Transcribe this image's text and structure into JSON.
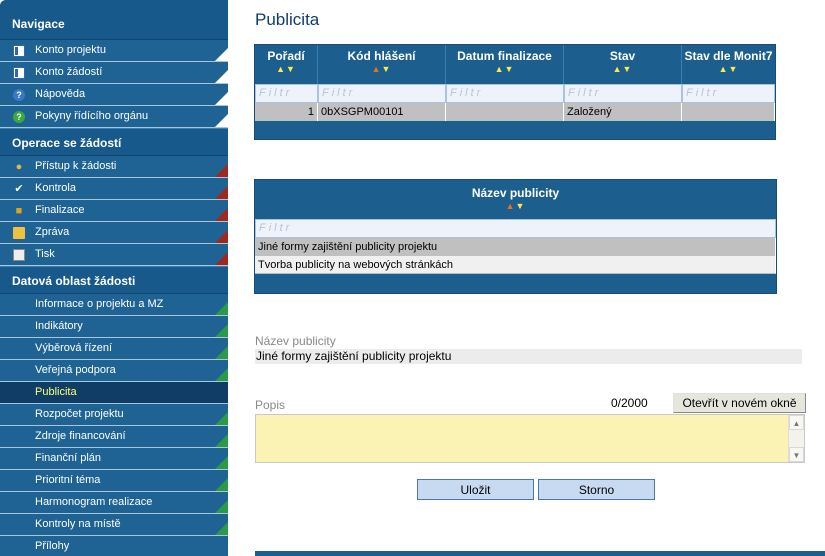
{
  "nav": {
    "sections": [
      {
        "title": "Navigace",
        "items": [
          {
            "label": "Konto projektu",
            "icon": "document-icon"
          },
          {
            "label": "Konto žádostí",
            "icon": "document-icon"
          },
          {
            "label": "Nápověda",
            "icon": "help-icon"
          },
          {
            "label": "Pokyny řídícího orgánu",
            "icon": "help-icon"
          }
        ]
      },
      {
        "title": "Operace se žádostí",
        "items": [
          {
            "label": "Přístup k žádosti",
            "icon": "people-icon"
          },
          {
            "label": "Kontrola",
            "icon": "check-icon"
          },
          {
            "label": "Finalizace",
            "icon": "lock-icon"
          },
          {
            "label": "Zpráva",
            "icon": "mail-icon"
          },
          {
            "label": "Tisk",
            "icon": "print-icon"
          }
        ]
      },
      {
        "title": "Datová oblast žádosti",
        "items": [
          {
            "label": "Informace o projektu a MZ"
          },
          {
            "label": "Indikátory"
          },
          {
            "label": "Výběrová řízení"
          },
          {
            "label": "Veřejná podpora"
          },
          {
            "label": "Publicita"
          },
          {
            "label": "Rozpočet projektu"
          },
          {
            "label": "Zdroje financování"
          },
          {
            "label": "Finanční plán"
          },
          {
            "label": "Prioritní téma"
          },
          {
            "label": "Harmonogram realizace"
          },
          {
            "label": "Kontroly na místě"
          },
          {
            "label": "Přílohy"
          }
        ]
      }
    ],
    "active_item": "Publicita"
  },
  "page": {
    "title": "Publicita"
  },
  "grid1": {
    "columns": [
      "Pořadí",
      "Kód hlášení",
      "Datum finalizace",
      "Stav",
      "Stav dle Monit7"
    ],
    "filter_placeholder": "Filtr",
    "rows": [
      {
        "poradi": "1",
        "kod": "0bXSGPM00101",
        "datum": "",
        "stav": "Založený",
        "monit": ""
      }
    ]
  },
  "grid2": {
    "column": "Název publicity",
    "filter_placeholder": "Filtr",
    "rows": [
      "Jiné formy zajištění publicity projektu",
      "Tvorba publicity na webových stránkách"
    ]
  },
  "detail": {
    "nazev_label": "Název publicity",
    "nazev_value": "Jiné formy zajištění publicity projektu",
    "popis_label": "Popis",
    "counter": "0/2000",
    "open_window_label": "Otevřít v novém okně",
    "save_label": "Uložit",
    "cancel_label": "Storno"
  },
  "colors": {
    "sidebar": "#1c5f8e",
    "active_text": "#ffff7a",
    "title": "#0d3d6e",
    "textarea_bg": "#fbf3b3"
  }
}
